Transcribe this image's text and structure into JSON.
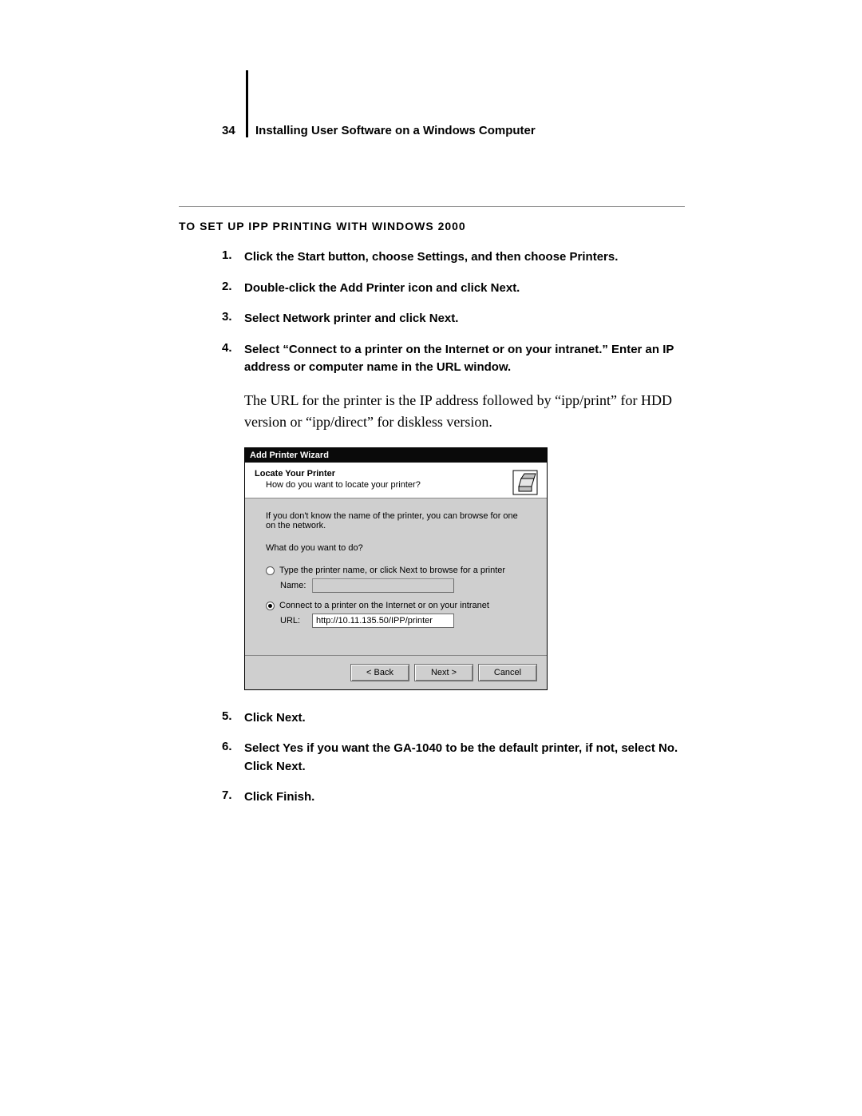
{
  "page_number": "34",
  "running_title": "Installing User Software on a Windows Computer",
  "section_heading": "TO SET UP IPP PRINTING WITH WINDOWS 2000",
  "steps_before": [
    {
      "n": "1.",
      "t": "Click the Start button, choose Settings, and then choose Printers."
    },
    {
      "n": "2.",
      "t": "Double-click the Add Printer icon and click Next."
    },
    {
      "n": "3.",
      "t": "Select Network printer and click Next."
    },
    {
      "n": "4.",
      "t": "Select “Connect to a printer on the Internet or on your intranet.” Enter an IP address or computer name in the URL window."
    }
  ],
  "explain": "The URL for the printer is the IP address followed by “ipp/print” for HDD version or “ipp/direct” for diskless version.",
  "wizard": {
    "title": "Add Printer Wizard",
    "head_title": "Locate Your Printer",
    "head_sub": "How do you want to locate your printer?",
    "info": "If you don't know the name of the printer, you can browse for one on the network.",
    "question": "What do you want to do?",
    "opt1": "Type the printer name, or click Next to browse for a printer",
    "name_label": "Name:",
    "name_value": "",
    "opt2": "Connect to a printer on the Internet or on your intranet",
    "url_label": "URL:",
    "url_value": "http://10.11.135.50/IPP/printer",
    "back": "< Back",
    "next": "Next >",
    "cancel": "Cancel"
  },
  "steps_after": [
    {
      "n": "5.",
      "t": "Click Next."
    },
    {
      "n": "6.",
      "t": "Select Yes if you want the GA-1040 to be the default printer, if not, select No. Click Next."
    },
    {
      "n": "7.",
      "t": "Click Finish."
    }
  ]
}
